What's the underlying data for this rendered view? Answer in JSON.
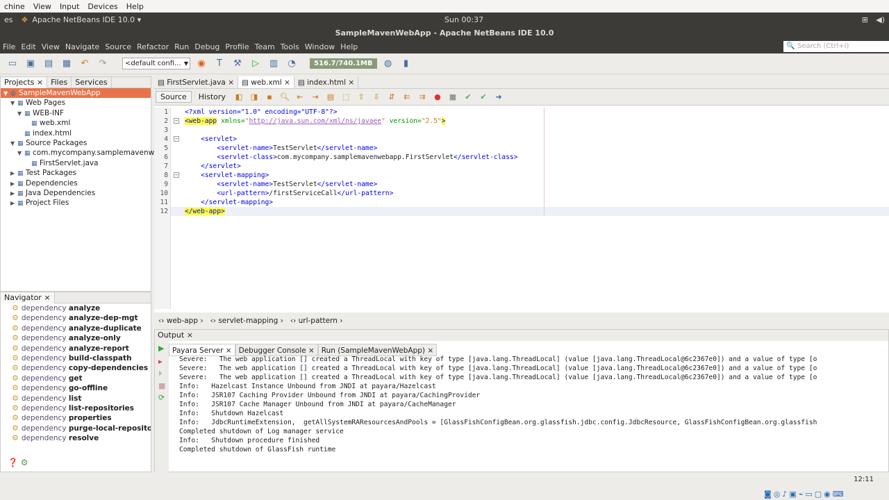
{
  "vbox_menu": [
    "chine",
    "View",
    "Input",
    "Devices",
    "Help"
  ],
  "panel": {
    "left": "es",
    "app": "Apache NetBeans IDE 10.0 ▾",
    "clock": "Sun 00:37"
  },
  "window_title": "SampleMavenWebApp - Apache NetBeans IDE 10.0",
  "menu": [
    "File",
    "Edit",
    "View",
    "Navigate",
    "Source",
    "Refactor",
    "Run",
    "Debug",
    "Profile",
    "Team",
    "Tools",
    "Window",
    "Help"
  ],
  "search_placeholder": "Search (Ctrl+I)",
  "toolbar": {
    "config": "<default confi...",
    "memory": "516.7/740.1MB"
  },
  "project_tabs": [
    "Projects",
    "Files",
    "Services"
  ],
  "tree": [
    {
      "label": "SampleMavenWebApp",
      "depth": 0,
      "arrow": "▼",
      "sel": true
    },
    {
      "label": "Web Pages",
      "depth": 1,
      "arrow": "▼"
    },
    {
      "label": "WEB-INF",
      "depth": 2,
      "arrow": "▼"
    },
    {
      "label": "web.xml",
      "depth": 3,
      "arrow": ""
    },
    {
      "label": "index.html",
      "depth": 2,
      "arrow": ""
    },
    {
      "label": "Source Packages",
      "depth": 1,
      "arrow": "▼"
    },
    {
      "label": "com.mycompany.samplemavenwebapp",
      "depth": 2,
      "arrow": "▼"
    },
    {
      "label": "FirstServlet.java",
      "depth": 3,
      "arrow": ""
    },
    {
      "label": "Test Packages",
      "depth": 1,
      "arrow": "▶"
    },
    {
      "label": "Dependencies",
      "depth": 1,
      "arrow": "▶"
    },
    {
      "label": "Java Dependencies",
      "depth": 1,
      "arrow": "▶"
    },
    {
      "label": "Project Files",
      "depth": 1,
      "arrow": "▶"
    }
  ],
  "navigator": {
    "title": "Navigator",
    "prefix": "dependency",
    "goals": [
      "analyze",
      "analyze-dep-mgt",
      "analyze-duplicate",
      "analyze-only",
      "analyze-report",
      "build-classpath",
      "copy-dependencies",
      "get",
      "go-offline",
      "list",
      "list-repositories",
      "properties",
      "purge-local-repository",
      "resolve"
    ]
  },
  "editor_tabs": [
    "FirstServlet.java",
    "web.xml",
    "index.html"
  ],
  "editor_modes": [
    "Source",
    "History"
  ],
  "code": [
    [
      [
        "tag",
        "<?xml version=\"1.0\" encoding=\"UTF-8\"?>"
      ]
    ],
    [
      [
        "tag hl",
        "<web-app"
      ],
      [
        "att",
        " xmlns="
      ],
      [
        "val",
        "\""
      ],
      [
        "lnk",
        "http://java.sun.com/xml/ns/javaee"
      ],
      [
        "val",
        "\""
      ],
      [
        "att",
        " version="
      ],
      [
        "val",
        "\"2.5\""
      ],
      [
        "tag hl",
        ">"
      ]
    ],
    [],
    [
      [
        "tag",
        "    <servlet>"
      ]
    ],
    [
      [
        "tag",
        "        <servlet-name>"
      ],
      [
        "txt",
        "TestServlet"
      ],
      [
        "tag",
        "</servlet-name>"
      ]
    ],
    [
      [
        "tag",
        "        <servlet-class>"
      ],
      [
        "txt",
        "com.mycompany.samplemavenwebapp.FirstServlet"
      ],
      [
        "tag",
        "</servlet-class>"
      ]
    ],
    [
      [
        "tag",
        "    </servlet>"
      ]
    ],
    [
      [
        "tag",
        "    <servlet-mapping>"
      ]
    ],
    [
      [
        "tag",
        "        <servlet-name>"
      ],
      [
        "txt",
        "TestServlet"
      ],
      [
        "tag",
        "</servlet-name>"
      ]
    ],
    [
      [
        "tag",
        "        <url-pattern>"
      ],
      [
        "txt",
        "/firstServiceCall"
      ],
      [
        "tag",
        "</url-pattern>"
      ]
    ],
    [
      [
        "tag",
        "    </servlet-mapping>"
      ]
    ],
    [
      [
        "tag hl",
        "</web-app>"
      ]
    ]
  ],
  "breadcrumb": [
    "web-app",
    "servlet-mapping",
    "url-pattern"
  ],
  "output": {
    "title": "Output",
    "tabs": [
      "Payara Server",
      "Debugger Console",
      "Run (SampleMavenWebApp)"
    ],
    "lines": [
      "Severe:   The web application [] created a ThreadLocal with key of type [java.lang.ThreadLocal] (value [java.lang.ThreadLocal@6c2367e0]) and a value of type [o",
      "Severe:   The web application [] created a ThreadLocal with key of type [java.lang.ThreadLocal] (value [java.lang.ThreadLocal@6c2367e0]) and a value of type [o",
      "Severe:   The web application [] created a ThreadLocal with key of type [java.lang.ThreadLocal] (value [java.lang.ThreadLocal@6c2367e0]) and a value of type [o",
      "Info:   Hazelcast Instance Unbound from JNDI at payara/Hazelcast",
      "Info:   JSR107 Caching Provider Unbound from JNDI at payara/CachingProvider",
      "Info:   JSR107 Cache Manager Unbound from JNDI at payara/CacheManager",
      "Info:   Shutdown Hazelcast",
      "Info:   JdbcRuntimeExtension,  getAllSystemRAResourcesAndPools = [GlassFishConfigBean.org.glassfish.jdbc.config.JdbcResource, GlassFishConfigBean.org.glassfish",
      "Completed shutdown of Log manager service",
      "Info:   Shutdown procedure finished",
      "Completed shutdown of GlassFish runtime"
    ]
  },
  "status_position": "12:11"
}
